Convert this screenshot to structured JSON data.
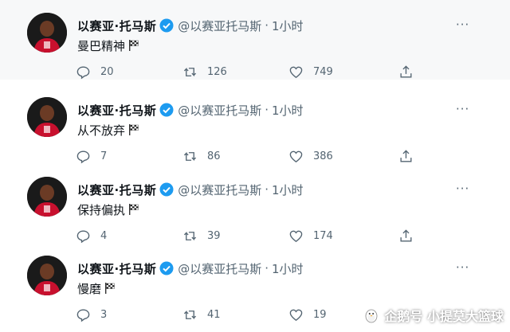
{
  "tweets": [
    {
      "display_name": "以赛亚·托马斯",
      "handle": "@以赛亚托马斯",
      "dot": "·",
      "time": "1小时",
      "text": "曼巴精神",
      "replies": "20",
      "retweets": "126",
      "likes": "749"
    },
    {
      "display_name": "以赛亚·托马斯",
      "handle": "@以赛亚托马斯",
      "dot": "·",
      "time": "1小时",
      "text": "从不放弃",
      "replies": "7",
      "retweets": "86",
      "likes": "386"
    },
    {
      "display_name": "以赛亚·托马斯",
      "handle": "@以赛亚托马斯",
      "dot": "·",
      "time": "1小时",
      "text": "保持偏执",
      "replies": "4",
      "retweets": "39",
      "likes": "174"
    },
    {
      "display_name": "以赛亚·托马斯",
      "handle": "@以赛亚托马斯",
      "dot": "·",
      "time": "1小时",
      "text": "慢磨",
      "replies": "3",
      "retweets": "41",
      "likes": "19"
    }
  ],
  "more_label": "···",
  "watermark": {
    "text": "企鹅号 小提莫大篮球",
    "icon": "penguin-logo-icon"
  },
  "colors": {
    "verified": "#1d9bf0",
    "muted_text": "#536471",
    "main_text": "#0f1419",
    "highlight_bg": "#f7f8f9"
  },
  "icons": {
    "reply": "reply-icon",
    "retweet": "retweet-icon",
    "like": "heart-icon",
    "share": "share-icon",
    "verified": "verified-badge-icon",
    "flag": "chequered-flag-icon",
    "more": "more-options-icon"
  }
}
